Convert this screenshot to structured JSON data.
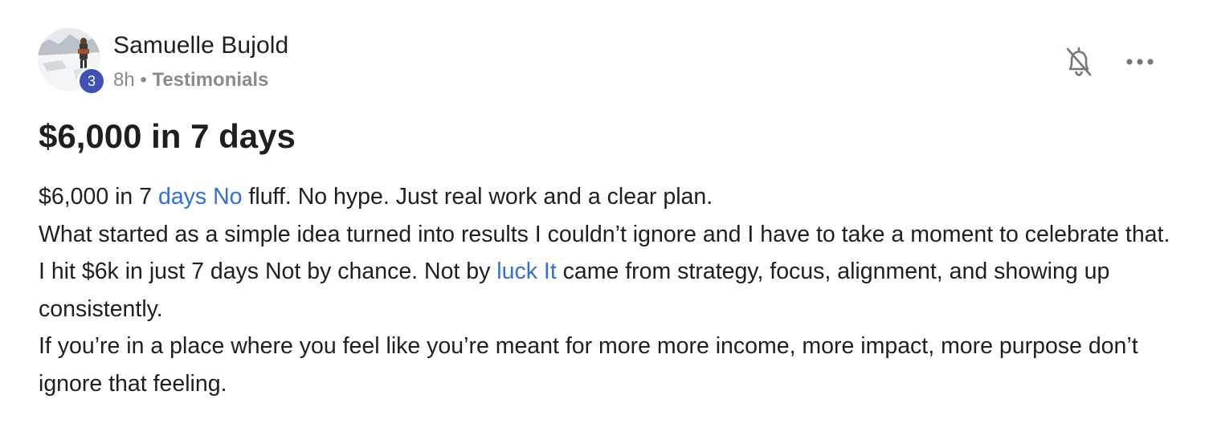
{
  "author": {
    "name": "Samuelle Bujold",
    "level": "3"
  },
  "meta": {
    "time": "8h",
    "separator": "•",
    "category": "Testimonials"
  },
  "post": {
    "title": "$6,000 in 7 days",
    "line1": {
      "pre": "$6,000 in 7 ",
      "link": "days No",
      "post": " fluff. No hype. Just real work and a clear plan."
    },
    "line2": "What started as a simple idea turned into results I couldn’t ignore and I have to take a moment to celebrate that.",
    "line3": {
      "pre": "I hit $6k in just 7 days Not by chance. Not by ",
      "link": "luck It",
      "post": " came from strategy, focus, alignment, and showing up consistently."
    },
    "line4": "If you’re in a place where you feel like you’re meant for more more income, more impact, more purpose don’t ignore that feeling."
  },
  "icons": {
    "notifications": "bell-off-icon",
    "more": "more-horizontal-icon"
  },
  "colors": {
    "text": "#1f1f1f",
    "muted": "#8a8a8a",
    "link": "#2f6fe0",
    "badge": "#3f51b5"
  }
}
